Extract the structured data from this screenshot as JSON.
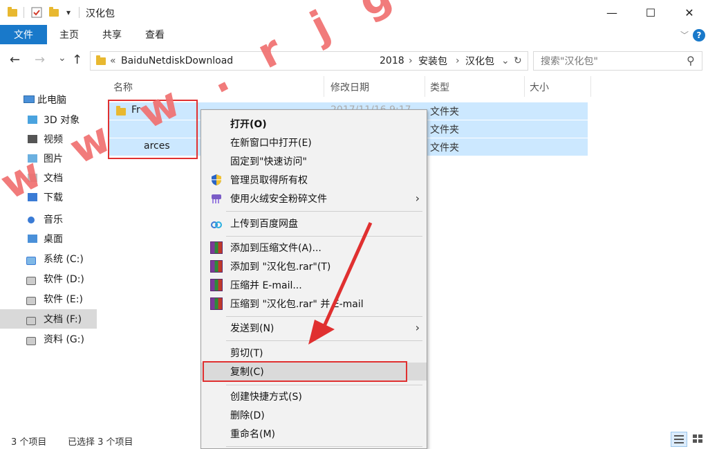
{
  "titlebar": {
    "title": "汉化包",
    "qa_dropdown": "▾",
    "minimize": "—",
    "maximize": "☐",
    "close": "✕"
  },
  "ribbon": {
    "tabs": [
      "文件",
      "主页",
      "共享",
      "查看"
    ],
    "expand": "﹀",
    "help": "?"
  },
  "nav_buttons": {
    "back": "←",
    "forward": "→",
    "recent": "⌄",
    "up": "↑"
  },
  "address": {
    "overflow": "«",
    "crumbs": [
      "BaiduNetdiskDownload",
      "2018",
      "安装包",
      "汉化包"
    ],
    "sep": "›",
    "dropdown": "⌄",
    "refresh": "↻"
  },
  "search": {
    "placeholder": "搜索\"汉化包\"",
    "icon": "⚲"
  },
  "sidebar": {
    "items": [
      {
        "label": "此电脑"
      },
      {
        "label": "3D 对象"
      },
      {
        "label": "视频"
      },
      {
        "label": "图片"
      },
      {
        "label": "文档"
      },
      {
        "label": "下载"
      },
      {
        "label": "音乐"
      },
      {
        "label": "桌面"
      },
      {
        "label": "系统 (C:)"
      },
      {
        "label": "软件 (D:)"
      },
      {
        "label": "软件 (E:)"
      },
      {
        "label": "文档 (F:)"
      },
      {
        "label": "资料 (G:)"
      }
    ]
  },
  "columns": [
    "名称",
    "修改日期",
    "类型",
    "大小"
  ],
  "rows": [
    {
      "name": "Fr",
      "date": "2017/11/16 9:17",
      "type": "文件夹"
    },
    {
      "name": "",
      "date": "",
      "type": "文件夹"
    },
    {
      "name": "arces",
      "date": "",
      "type": "文件夹"
    }
  ],
  "status": {
    "count": "3 个项目",
    "selected": "已选择 3 个项目"
  },
  "context_menu": {
    "items": [
      {
        "label": "打开(O)",
        "bold": true
      },
      {
        "label": "在新窗口中打开(E)"
      },
      {
        "label": "固定到\"快速访问\""
      },
      {
        "label": "管理员取得所有权"
      },
      {
        "label": "使用火绒安全粉碎文件"
      },
      {
        "label": "上传到百度网盘"
      },
      {
        "label": "添加到压缩文件(A)..."
      },
      {
        "label": "添加到 \"汉化包.rar\"(T)"
      },
      {
        "label": "压缩并 E-mail..."
      },
      {
        "label": "压缩到 \"汉化包.rar\" 并 E-mail"
      },
      {
        "label": "发送到(N)"
      },
      {
        "label": "剪切(T)"
      },
      {
        "label": "复制(C)"
      },
      {
        "label": "创建快捷方式(S)"
      },
      {
        "label": "删除(D)"
      },
      {
        "label": "重命名(M)"
      }
    ],
    "submenu_arrow": "›"
  },
  "watermark": "w w w . r j g x g j . c o m",
  "colors": {
    "accent": "#1979ca",
    "selection": "#cce8ff",
    "highlight_red": "#e03030",
    "watermark": "#f07070"
  }
}
